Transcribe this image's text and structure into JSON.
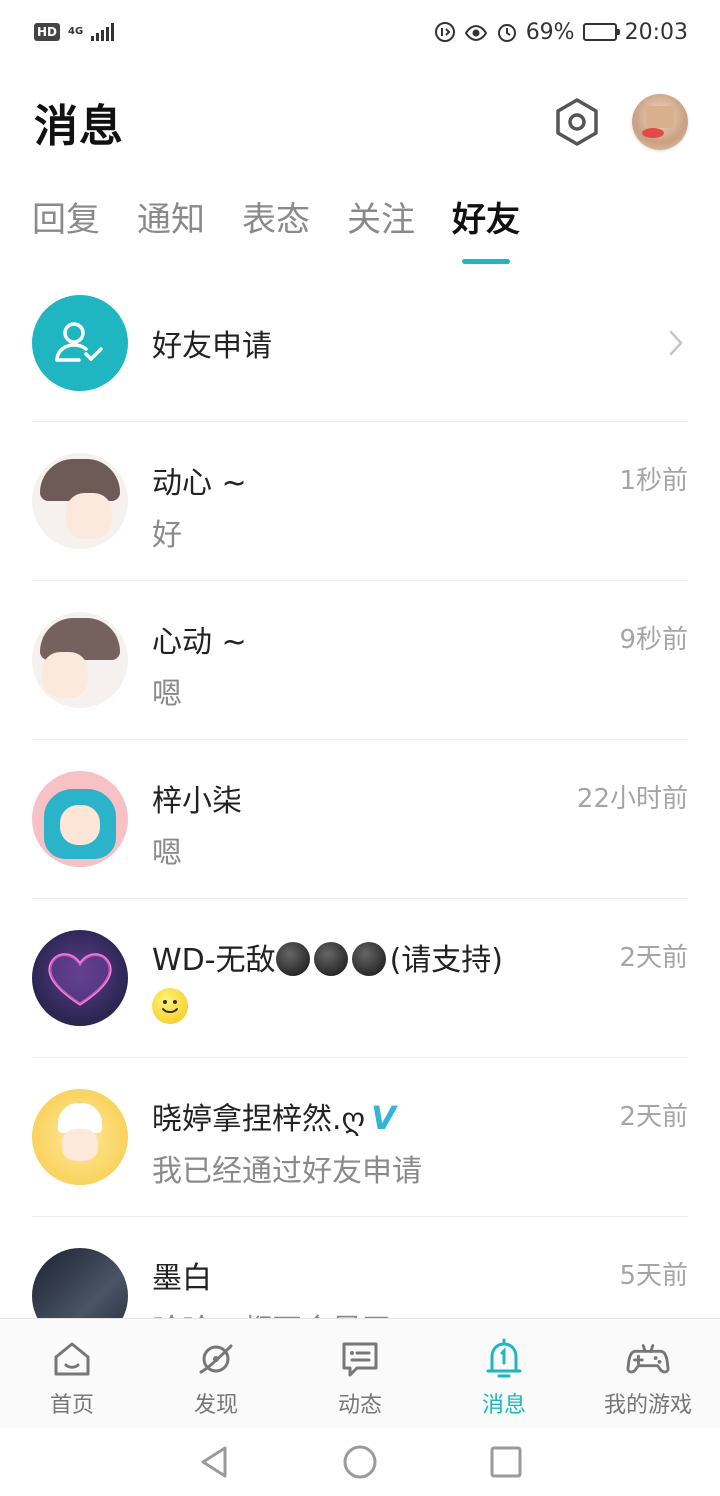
{
  "status": {
    "hd_badge": "HD",
    "network_top": "4G",
    "network_bottom": "4G",
    "battery_text": "69%",
    "battery_level": 0.69,
    "time": "20:03"
  },
  "header": {
    "title": "消息",
    "settings_icon": "settings-hexagon-icon"
  },
  "tabs": [
    {
      "label": "回复",
      "active": false
    },
    {
      "label": "通知",
      "active": false
    },
    {
      "label": "表态",
      "active": false
    },
    {
      "label": "关注",
      "active": false
    },
    {
      "label": "好友",
      "active": true
    }
  ],
  "friend_request": {
    "label": "好友申请",
    "icon": "user-check-icon",
    "accent": "#1fb6c1"
  },
  "conversations": [
    {
      "name": "动心 ~",
      "message": "好",
      "time": "1秒前"
    },
    {
      "name": "心动 ~",
      "message": "嗯",
      "time": "9秒前"
    },
    {
      "name": "梓小柒",
      "message": "嗯",
      "time": "22小时前"
    },
    {
      "name_prefix": "WD-无敌",
      "name_suffix": "(请支持)",
      "message_icon": "smiley-emoji-icon",
      "time": "2天前"
    },
    {
      "name": "晓婷拿捏梓然.ღ",
      "verified": "V",
      "message": "我已经通过好友申请",
      "time": "2天前"
    },
    {
      "name": "墨白",
      "message": "哈哈，都不会是了",
      "time": "5天前"
    }
  ],
  "bottom_nav": [
    {
      "label": "首页",
      "icon": "home-icon",
      "active": false
    },
    {
      "label": "发现",
      "icon": "planet-icon",
      "active": false
    },
    {
      "label": "动态",
      "icon": "chat-bubble-icon",
      "active": false
    },
    {
      "label": "消息",
      "icon": "bell-icon",
      "active": true
    },
    {
      "label": "我的游戏",
      "icon": "gamepad-icon",
      "active": false
    }
  ],
  "colors": {
    "accent": "#1fb6c1",
    "inactive_text": "#8a8a8a",
    "time_text": "#a5a5a5"
  }
}
